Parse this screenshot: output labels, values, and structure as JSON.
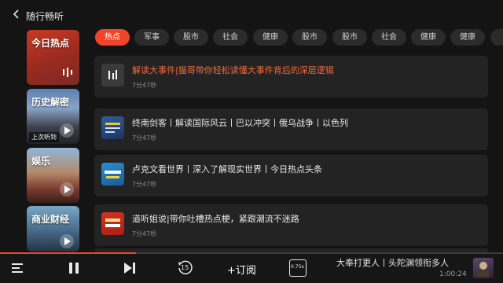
{
  "header": {
    "title": "随行畅听"
  },
  "sidebar": {
    "items": [
      {
        "label": "今日热点",
        "tag": ""
      },
      {
        "label": "历史解密",
        "tag": "上次听到"
      },
      {
        "label": "娱乐",
        "tag": ""
      },
      {
        "label": "商业财经",
        "tag": ""
      }
    ]
  },
  "chips": [
    "热点",
    "军事",
    "股市",
    "社会",
    "健康",
    "股市",
    "股市",
    "社会",
    "健康",
    "健康"
  ],
  "episodes": [
    {
      "title": "解读大事件|猫哥带你轻松读懂大事件背后的深层逻辑",
      "duration": "7分47秒",
      "playing": true
    },
    {
      "title": "终南剑客丨解读国际风云丨巴以冲突丨俄乌战争丨以色列",
      "duration": "7分47秒",
      "playing": false
    },
    {
      "title": "卢克文看世界丨深入了解现实世界丨今日热点头条",
      "duration": "7分47秒",
      "playing": false
    },
    {
      "title": "道听姐说|带你吐槽热点梗，紧跟潮流不迷路",
      "duration": "7分47秒",
      "playing": false
    }
  ],
  "player": {
    "subscribe_label": "+订阅",
    "skip_back_seconds": "15",
    "speed": "0.75x",
    "now_playing": "大奉打更人丨头陀渊领衔多人",
    "time": "1:00:24",
    "progress": 0.27
  },
  "colors": {
    "accent": "#f0452a",
    "background": "#141414",
    "card": "#232323"
  }
}
